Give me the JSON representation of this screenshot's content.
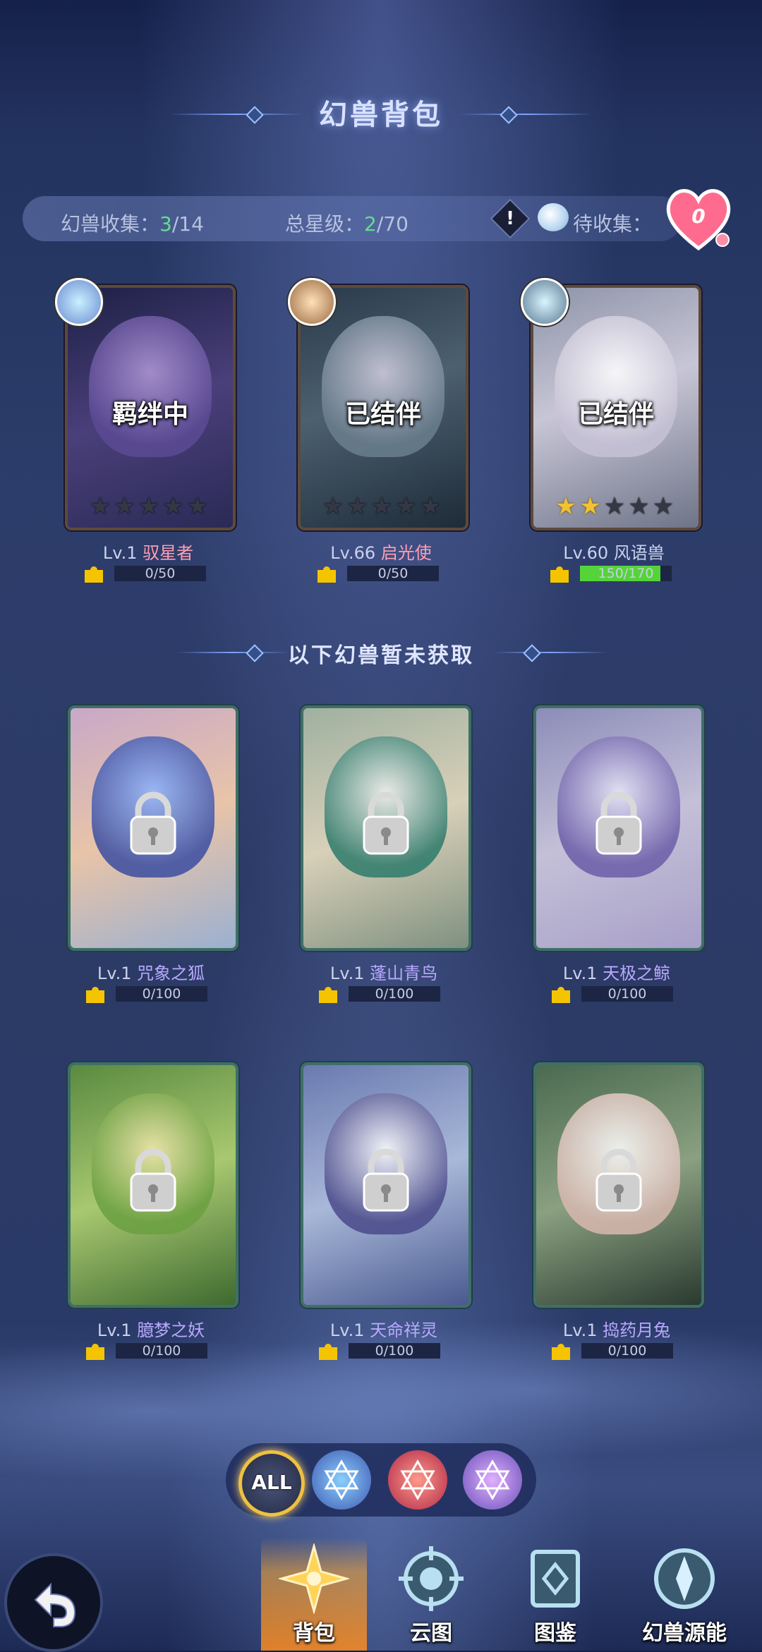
{
  "header": {
    "title": "幻兽背包"
  },
  "stats": {
    "collect_label": "幻兽收集：",
    "collect_owned": "3",
    "collect_total": "/14",
    "star_label": "总星级：",
    "star_owned": "2",
    "star_total": "/70",
    "pending_label": "待收集：",
    "hearts": "0"
  },
  "owned": [
    {
      "status": "羁绊中",
      "level": "Lv.1",
      "name": "驭星者",
      "progress": "0/50",
      "fill": 0,
      "stars": 0
    },
    {
      "status": "已结伴",
      "level": "Lv.66",
      "name": "启光使",
      "progress": "0/50",
      "fill": 0,
      "stars": 0
    },
    {
      "status": "已结伴",
      "level": "Lv.60",
      "name": "风语兽",
      "progress": "150/170",
      "fill": 0.88,
      "stars": 2
    }
  ],
  "section": {
    "unobtained_title": "以下幻兽暂未获取"
  },
  "locked": [
    {
      "level": "Lv.1",
      "name": "咒象之狐",
      "progress": "0/100"
    },
    {
      "level": "Lv.1",
      "name": "蓬山青鸟",
      "progress": "0/100"
    },
    {
      "level": "Lv.1",
      "name": "天极之鲸",
      "progress": "0/100"
    },
    {
      "level": "Lv.1",
      "name": "臆梦之妖",
      "progress": "0/100"
    },
    {
      "level": "Lv.1",
      "name": "天命祥灵",
      "progress": "0/100"
    },
    {
      "level": "Lv.1",
      "name": "捣药月兔",
      "progress": "0/100"
    }
  ],
  "filter": {
    "all_label": "ALL",
    "icons": [
      "star-hexagram-blue-icon",
      "star-hexagram-red-icon",
      "star-hexagram-purple-icon"
    ]
  },
  "nav": {
    "tabs": [
      {
        "label": "背包",
        "active": true
      },
      {
        "label": "云图",
        "active": false
      },
      {
        "label": "图鉴",
        "active": false
      },
      {
        "label": "幻兽源能",
        "active": false
      }
    ]
  },
  "colors": {
    "accent_green": "#5fe08a",
    "owned_name": "#ff9fb4",
    "locked_name": "#b9a9ff",
    "active_tab": "#ffa02e"
  }
}
